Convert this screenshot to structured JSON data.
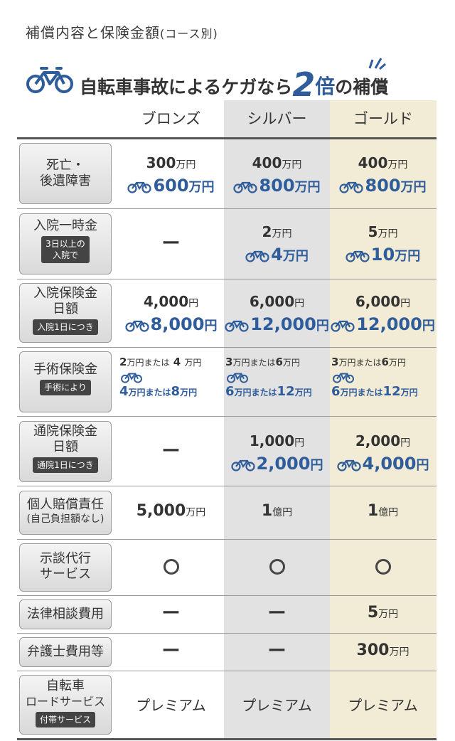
{
  "title": {
    "main": "補償内容と保険金額",
    "sub": "(コース別)"
  },
  "headline": {
    "text1": "自転車事故によるケガなら",
    "num": "2",
    "bai": "倍",
    "text2": "の補償"
  },
  "columns": {
    "bronze": "ブロンズ",
    "silver": "シルバー",
    "gold": "ゴールド"
  },
  "colors": {
    "accent": "#2f5d9b",
    "silver_bg": "#e2e2e2",
    "gold_bg": "#f2ecd6"
  },
  "rows": {
    "death": {
      "label1": "死亡・",
      "label2": "後遺障害",
      "bronze": {
        "base": "300",
        "base_u": "万円",
        "bike": "600",
        "bike_u": "万円"
      },
      "silver": {
        "base": "400",
        "base_u": "万円",
        "bike": "800",
        "bike_u": "万円"
      },
      "gold": {
        "base": "400",
        "base_u": "万円",
        "bike": "800",
        "bike_u": "万円"
      }
    },
    "hosp_lump": {
      "label1": "入院一時金",
      "pill": "3日以上の\n入院で",
      "pill1": "3日以上の",
      "pill2": "入院で",
      "bronze": "ー",
      "silver": {
        "base": "2",
        "base_u": "万円",
        "bike": "4",
        "bike_u": "万円"
      },
      "gold": {
        "base": "5",
        "base_u": "万円",
        "bike": "10",
        "bike_u": "万円"
      }
    },
    "hosp_daily": {
      "label1": "入院保険金",
      "label2": "日額",
      "pill": "入院1日につき",
      "bronze": {
        "base": "4,000",
        "base_u": "円",
        "bike": "8,000",
        "bike_u": "円"
      },
      "silver": {
        "base": "6,000",
        "base_u": "円",
        "bike": "12,000",
        "bike_u": "円"
      },
      "gold": {
        "base": "6,000",
        "base_u": "円",
        "bike": "12,000",
        "bike_u": "円"
      }
    },
    "surgery": {
      "label1": "手術保険金",
      "pill": "手術により",
      "bronze": {
        "a": "2",
        "a_u": "万円または",
        "b": "4",
        "b_u": "万円",
        "c": "4",
        "c_u": "万円または",
        "d": "8",
        "d_u": "万円"
      },
      "silver": {
        "a": "3",
        "a_u": "万円または",
        "b": "6",
        "b_u": "万円",
        "c": "6",
        "c_u": "万円または",
        "d": "12",
        "d_u": "万円"
      },
      "gold": {
        "a": "3",
        "a_u": "万円または",
        "b": "6",
        "b_u": "万円",
        "c": "6",
        "c_u": "万円または",
        "d": "12",
        "d_u": "万円"
      }
    },
    "outpatient": {
      "label1": "通院保険金",
      "label2": "日額",
      "pill": "通院1日につき",
      "bronze": "ー",
      "silver": {
        "base": "1,000",
        "base_u": "円",
        "bike": "2,000",
        "bike_u": "円"
      },
      "gold": {
        "base": "2,000",
        "base_u": "円",
        "bike": "4,000",
        "bike_u": "円"
      }
    },
    "liability": {
      "label1": "個人賠償責任",
      "label2": "(自己負担額なし)",
      "bronze": {
        "v": "5,000",
        "u": "万円"
      },
      "silver": {
        "v": "1",
        "u": "億円"
      },
      "gold": {
        "v": "1",
        "u": "億円"
      }
    },
    "settlement": {
      "label1": "示談代行",
      "label2": "サービス",
      "bronze": "○",
      "silver": "○",
      "gold": "○"
    },
    "legal": {
      "label1": "法律相談費用",
      "bronze": "ー",
      "silver": "ー",
      "gold": {
        "v": "5",
        "u": "万円"
      }
    },
    "lawyer": {
      "label1": "弁護士費用等",
      "bronze": "ー",
      "silver": "ー",
      "gold": {
        "v": "300",
        "u": "万円"
      }
    },
    "road": {
      "label1": "自転車",
      "label2": "ロードサービス",
      "pill": "付帯サービス",
      "bronze": "プレミアム",
      "silver": "プレミアム",
      "gold": "プレミアム"
    }
  }
}
